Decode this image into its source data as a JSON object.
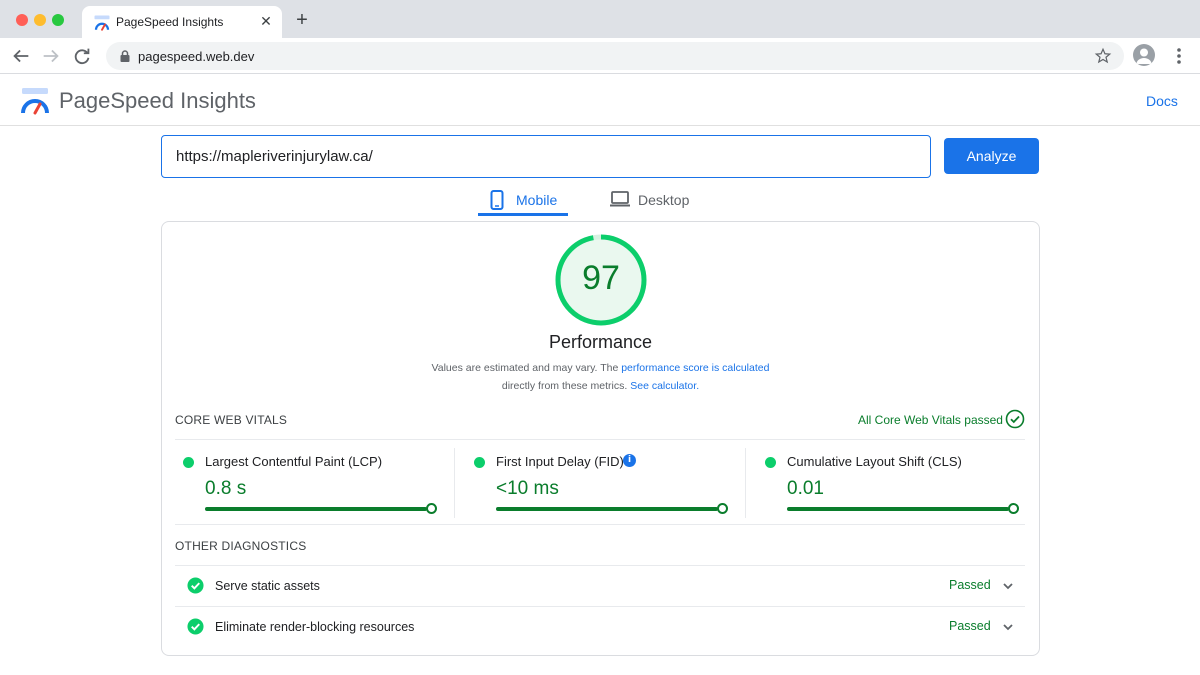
{
  "browser": {
    "tab_title": "PageSpeed Insights",
    "tab_close": "✕",
    "new_tab": "+",
    "address": "pagespeed.web.dev"
  },
  "header": {
    "title": "PageSpeed Insights",
    "docs_label": "Docs"
  },
  "analyze": {
    "url_value": "https://mapleriverinjurylaw.ca/",
    "button_label": "Analyze"
  },
  "device_tabs": [
    {
      "label": "Mobile",
      "active": true
    },
    {
      "label": "Desktop",
      "active": false
    }
  ],
  "performance": {
    "score": "97",
    "score_fraction": 0.97,
    "title": "Performance",
    "note_1": "Values are estimated and may vary. The ",
    "note_link_1": "performance score is calculated",
    "note_2": "directly from these metrics. ",
    "note_link_2": "See calculator."
  },
  "core_web_vitals": {
    "label": "CORE WEB VITALS",
    "status": "All Core Web Vitals passed",
    "metrics": [
      {
        "name": "Largest Contentful Paint (LCP)",
        "value": "0.8 s",
        "has_info": false
      },
      {
        "name": "First Input Delay (FID)",
        "value": "<10 ms",
        "has_info": true,
        "info_glyph": "i"
      },
      {
        "name": "Cumulative Layout Shift (CLS)",
        "value": "0.01",
        "has_info": false
      }
    ]
  },
  "diagnostics": {
    "label": "OTHER DIAGNOSTICS",
    "items": [
      {
        "name": "Serve static assets",
        "status": "Passed"
      },
      {
        "name": "Eliminate render-blocking resources",
        "status": "Passed"
      }
    ]
  },
  "colors": {
    "accent": "#1a73e8",
    "pass": "#0cce6b",
    "pass_text": "#0a7d2c"
  }
}
